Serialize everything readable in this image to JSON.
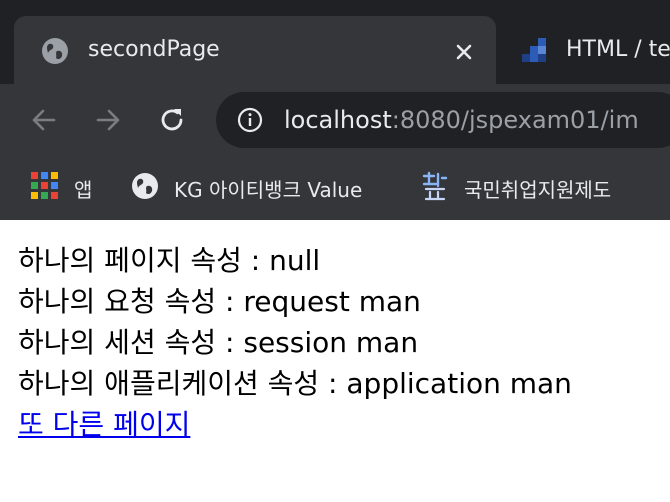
{
  "browser": {
    "active_tab": {
      "title": "secondPage",
      "favicon": "globe-icon"
    },
    "second_tab": {
      "title": "HTML / te",
      "favicon": "blocks-icon"
    },
    "address": {
      "host": "localhost",
      "rest": ":8080/jspexam01/im"
    },
    "bookmarks": [
      {
        "label": "앱",
        "icon": "apps-grid-icon"
      },
      {
        "label": "KG 아이티뱅크 Value",
        "icon": "globe-icon"
      },
      {
        "label": "국민취업지원제도",
        "icon": "site-logo-icon"
      }
    ]
  },
  "page": {
    "lines": [
      "하나의 페이지 속성 : null",
      "하나의 요청 속성 : request man",
      "하나의 세션 속성 : session man",
      "하나의 애플리케이션 속성 : application man"
    ],
    "link": "또 다른 페이지"
  }
}
